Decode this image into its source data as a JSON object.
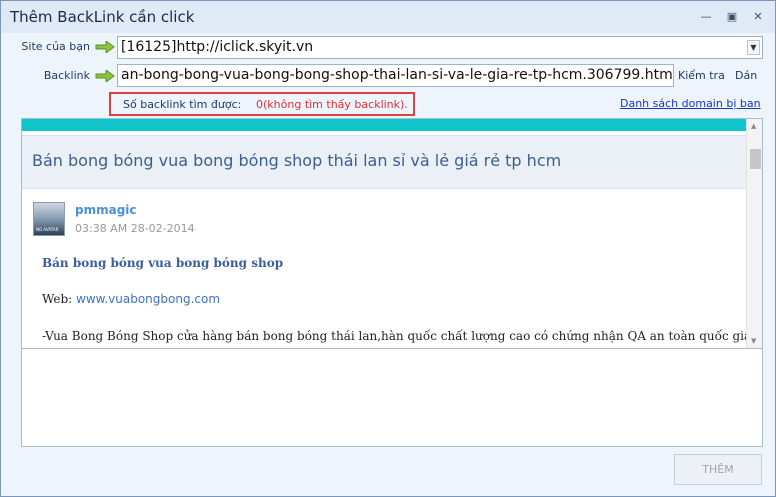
{
  "window": {
    "title": "Thêm BackLink cần click",
    "controls": [
      "minimize",
      "restore",
      "close"
    ]
  },
  "form": {
    "site_label": "Site của bạn",
    "site_value": "[16125]http://iclick.skyit.vn",
    "backlink_label": "Backlink",
    "backlink_value": "an-bong-bong-vua-bong-bong-shop-thai-lan-si-va-le-gia-re-tp-hcm.306799.html",
    "check_button": "Kiểm tra",
    "paste_button": "Dán"
  },
  "result": {
    "count_label": "Số backlink tìm được:",
    "count_value": "0(không tìm thấy backlink).",
    "domain_list_link": "Danh sách domain bị ban"
  },
  "page": {
    "thread_title": "Bán bong bóng vua bong bóng shop thái lan sỉ và lẻ giá rẻ tp hcm",
    "post": {
      "avatar_text": "NO AVATAR",
      "author": "pmmagic",
      "date": "03:38 AM 28-02-2014",
      "heading": "Bán bong bóng vua bong bóng shop",
      "web_label": "Web: ",
      "web_url": "www.vuabongbong.com",
      "body": "-Vua Bong Bóng Shop cửa hàng bán bong bóng thái lan,hàn quốc chất lượng cao có chứng nhận QA an toàn quốc gia cho"
    }
  },
  "footer": {
    "add_button": "THÊM"
  },
  "colors": {
    "accent_cyan": "#10c5c9",
    "error_red": "#e03030",
    "link_blue": "#1a34c7"
  }
}
